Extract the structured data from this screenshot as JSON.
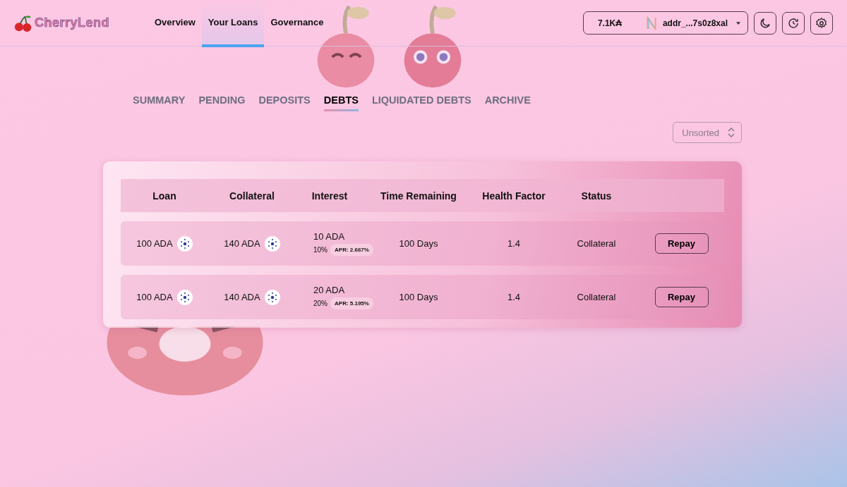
{
  "brand": {
    "name": "CherryLend"
  },
  "nav": [
    {
      "label": "Overview",
      "selected": false
    },
    {
      "label": "Your Loans",
      "selected": true
    },
    {
      "label": "Governance",
      "selected": false
    }
  ],
  "wallet": {
    "balance": "7.1K₳",
    "address": "addr_...7s0z8xal"
  },
  "tabs": [
    {
      "label": "SUMMARY",
      "selected": false
    },
    {
      "label": "PENDING",
      "selected": false
    },
    {
      "label": "DEPOSITS",
      "selected": false
    },
    {
      "label": "DEBTS",
      "selected": true
    },
    {
      "label": "LIQUIDATED DEBTS",
      "selected": false
    },
    {
      "label": "ARCHIVE",
      "selected": false
    }
  ],
  "sort": {
    "value": "Unsorted"
  },
  "table": {
    "columns": [
      "Loan",
      "Collateral",
      "Interest",
      "Time Remaining",
      "Health Factor",
      "Status"
    ],
    "rows": [
      {
        "loan": "100 ADA",
        "collateral": "140 ADA",
        "interest": "10 ADA",
        "rate": "10%",
        "apr": "APR: 2.667%",
        "time": "100 Days",
        "health": "1.4",
        "status": "Collateral",
        "action": "Repay"
      },
      {
        "loan": "100 ADA",
        "collateral": "140 ADA",
        "interest": "20 ADA",
        "rate": "20%",
        "apr": "APR: 5.195%",
        "time": "100 Days",
        "health": "1.4",
        "status": "Collateral",
        "action": "Repay"
      }
    ]
  }
}
